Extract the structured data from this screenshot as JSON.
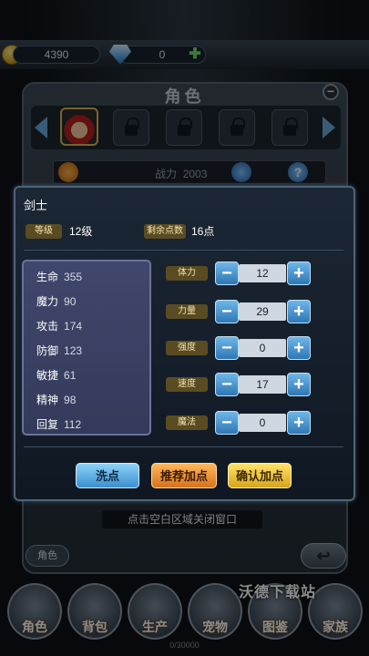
{
  "hud": {
    "gold": "4390",
    "gems": "0"
  },
  "role_panel": {
    "title": "角色",
    "power_label": "战力",
    "power_value": "2003",
    "close_hint": "点击空白区域关闭窗口",
    "tab_label": "角色"
  },
  "dialog": {
    "class_name": "剑士",
    "level_label": "等级",
    "level_value": "12级",
    "points_label": "剩余点数",
    "points_value": "16点",
    "stats": [
      {
        "name": "生命",
        "value": "355"
      },
      {
        "name": "魔力",
        "value": "90"
      },
      {
        "name": "攻击",
        "value": "174"
      },
      {
        "name": "防御",
        "value": "123"
      },
      {
        "name": "敏捷",
        "value": "61"
      },
      {
        "name": "精神",
        "value": "98"
      },
      {
        "name": "回复",
        "value": "112"
      }
    ],
    "attributes": [
      {
        "label": "体力",
        "value": "12"
      },
      {
        "label": "力量",
        "value": "29"
      },
      {
        "label": "强度",
        "value": "0"
      },
      {
        "label": "速度",
        "value": "17"
      },
      {
        "label": "魔法",
        "value": "0"
      }
    ],
    "buttons": {
      "reset": "洗点",
      "recommend": "推荐加点",
      "confirm": "确认加点"
    }
  },
  "bottom_nav": [
    "角色",
    "背包",
    "生产",
    "宠物",
    "图鉴",
    "家族"
  ],
  "watermark": "沃德下载站",
  "exp": "0/30000"
}
